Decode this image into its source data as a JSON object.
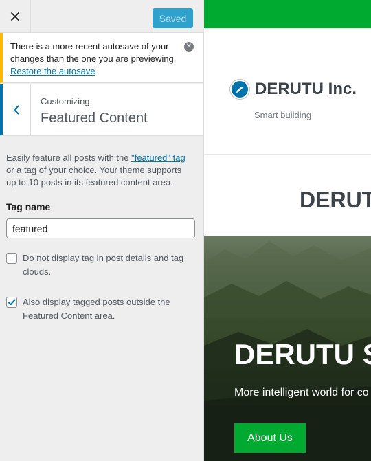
{
  "sidebar": {
    "close_label": "×",
    "saved_label": "Saved",
    "notice": {
      "text": "There is a more recent autosave of your changes than the one you are previewing. ",
      "link": "Restore the autosave"
    },
    "section": {
      "breadcrumb": "Customizing",
      "title": "Featured Content"
    },
    "description": {
      "part1": "Easily feature all posts with the ",
      "link": "\"featured\" tag",
      "part2": " or a tag of your choice. Your theme supports up to 10 posts in its featured content area."
    },
    "tag_field": {
      "label": "Tag name",
      "value": "featured"
    },
    "options": [
      {
        "label": "Do not display tag in post details and tag clouds.",
        "checked": false
      },
      {
        "label": "Also display tagged posts outside the Featured Content area.",
        "checked": true
      }
    ]
  },
  "preview": {
    "site_title": "DERUTU Inc.",
    "tagline": "Smart building",
    "section_heading": "DERUTU",
    "hero": {
      "title": "DERUTU SI",
      "subtitle": "More intelligent world for co",
      "button_label": "About Us"
    }
  },
  "colors": {
    "accent": "#0073aa",
    "brand_green": "#00a930",
    "notice_border": "#ffb900",
    "saved_button": "#2ea2cc"
  }
}
